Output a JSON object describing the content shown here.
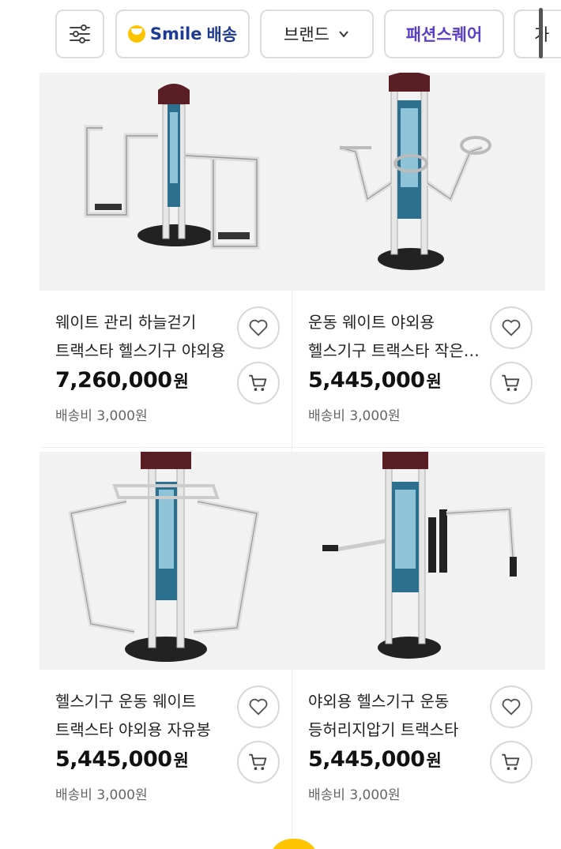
{
  "filter_bar": {
    "filter_icon": "sliders-icon",
    "smile": {
      "brand": "Smile",
      "suffix": "배송"
    },
    "brand": {
      "label": "브랜드",
      "icon": "chevron-down-icon"
    },
    "fashion": {
      "label": "패션스퀘어"
    },
    "partial": {
      "label": "가"
    }
  },
  "colors": {
    "accent_purple": "#5b3ec6",
    "smile_yellow": "#ffc400",
    "smile_blue": "#1f3a93"
  },
  "products": [
    {
      "title": "웨이트 관리 하늘걷기 트랙스타 헬스기구 야외용",
      "price": "7,260,000",
      "currency": "원",
      "shipping": "배송비 3,000원",
      "image": "air-walker-equipment"
    },
    {
      "title": "운동 웨이트 야외용 헬스기구 트랙스타 작은 파도",
      "price": "5,445,000",
      "currency": "원",
      "shipping": "배송비 3,000원",
      "image": "twister-wheel-equipment"
    },
    {
      "title": "헬스기구 운동 웨이트 트랙스타 야외용 자유봉",
      "price": "5,445,000",
      "currency": "원",
      "shipping": "배송비 3,000원",
      "image": "swing-bar-equipment"
    },
    {
      "title": "야외용 헬스기구 운동 등허리지압기 트랙스타",
      "price": "5,445,000",
      "currency": "원",
      "shipping": "배송비 3,000원",
      "image": "back-massager-equipment"
    }
  ]
}
